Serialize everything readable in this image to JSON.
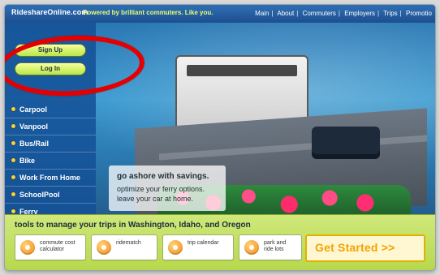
{
  "header": {
    "logo": "RideshareOnline.com",
    "tagline": "Powered by brilliant commuters. Like you.",
    "nav": [
      "Main",
      "About",
      "Commuters",
      "Employers",
      "Trips",
      "Promotio"
    ]
  },
  "sidebar": {
    "auth": {
      "sign_up": "Sign Up",
      "log_in": "Log In"
    },
    "menu": [
      "Carpool",
      "Vanpool",
      "Bus/Rail",
      "Bike",
      "Work From Home",
      "SchoolPool",
      "Ferry"
    ]
  },
  "promo": {
    "heading": "go ashore with savings.",
    "line1": "optimize your ferry options.",
    "line2": "leave your car at home."
  },
  "bottom": {
    "title": "tools to manage your trips in Washington, Idaho, and Oregon",
    "tools": [
      {
        "label_line1": "commute cost",
        "label_line2": "calculator",
        "icon": "calculator-icon"
      },
      {
        "label_line1": "ridematch",
        "label_line2": "",
        "icon": "people-icon"
      },
      {
        "label_line1": "trip calendar",
        "label_line2": "",
        "icon": "arrow-icon"
      },
      {
        "label_line1": "park and",
        "label_line2": "ride lots",
        "icon": "parking-icon"
      }
    ],
    "cta": "Get Started >>"
  },
  "colors": {
    "highlight_circle": "#e40000",
    "primary_blue": "#1c4f8f",
    "green_panel": "#b7d84c",
    "cta_orange": "#f2a300"
  }
}
